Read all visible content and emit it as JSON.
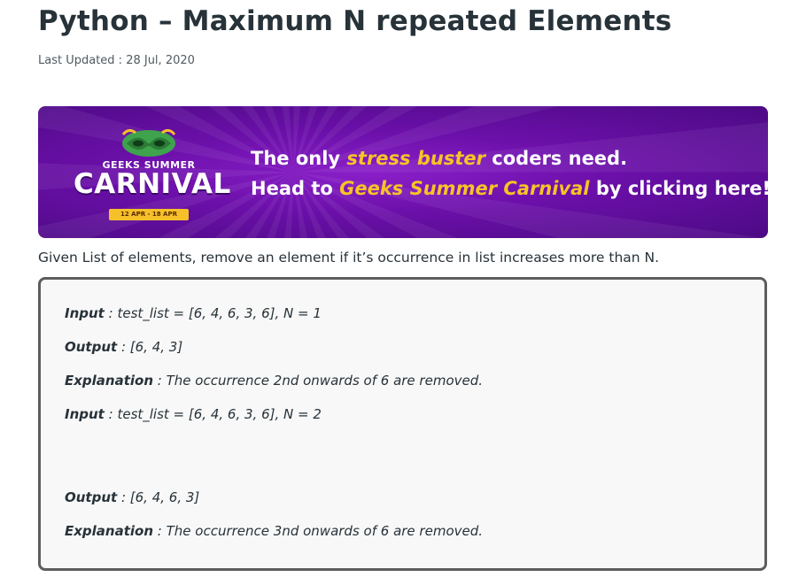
{
  "article": {
    "title": "Python – Maximum N repeated Elements",
    "last_updated": "Last Updated : 28 Jul, 2020"
  },
  "banner": {
    "logo_top": "GEEKS SUMMER",
    "logo_main": "CARNIVAL",
    "logo_dates": "12 APR - 18 APR",
    "line1_pre": "The only ",
    "line1_highlight": "stress buster",
    "line1_post": " coders need.",
    "line2_pre": "Head to ",
    "line2_highlight": "Geeks Summer Carnival",
    "line2_post": " by clicking here!",
    "colors": {
      "bg": "#6a0fa8",
      "highlight": "#f8c326"
    }
  },
  "intro": "Given List of elements, remove an element if it’s occurrence in list increases more than N.",
  "example": {
    "lines": [
      {
        "label": "Input",
        "sep": " : ",
        "value": " test_list = [6, 4, 6, 3, 6], N = 1"
      },
      {
        "label": "Output",
        "sep": " : ",
        "value": "[6, 4, 3]"
      },
      {
        "label": "Explanation",
        "sep": " : ",
        "value": " The occurrence 2nd onwards of 6 are removed."
      },
      {
        "label": "Input",
        "sep": " : ",
        "value": " test_list = [6, 4, 6, 3, 6], N = 2"
      },
      {
        "label": "Output",
        "sep": " : ",
        "value": "[6, 4, 6, 3]"
      },
      {
        "label": "Explanation",
        "sep": " : ",
        "value": " The occurrence 3nd onwards of 6 are removed."
      }
    ]
  }
}
